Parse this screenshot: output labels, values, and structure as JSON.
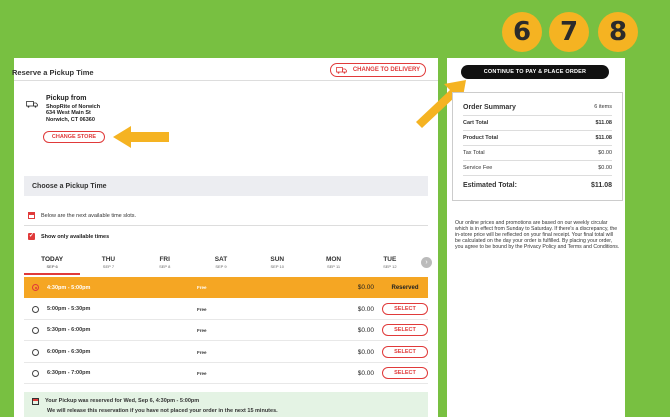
{
  "badges": [
    "6",
    "7",
    "8"
  ],
  "reserve": {
    "title": "Reserve a Pickup Time",
    "change_delivery": "CHANGE TO DELIVERY"
  },
  "pickup": {
    "title": "Pickup from",
    "store_name": "ShopRite of Norwich",
    "address1": "634 West Main St",
    "address2": "Norwich, CT 06360",
    "change_store": "CHANGE STORE"
  },
  "choose": {
    "title": "Choose a Pickup Time",
    "note": "Below are the next available time slots.",
    "checkbox_label": "Show only available times"
  },
  "days": [
    {
      "name": "TODAY",
      "date": "SEP 6"
    },
    {
      "name": "THU",
      "date": "SEP 7"
    },
    {
      "name": "FRI",
      "date": "SEP 8"
    },
    {
      "name": "SAT",
      "date": "SEP 9"
    },
    {
      "name": "SUN",
      "date": "SEP 10"
    },
    {
      "name": "MON",
      "date": "SEP 11"
    },
    {
      "name": "TUE",
      "date": "SEP 12"
    }
  ],
  "slots": [
    {
      "time": "4:30pm - 5:00pm",
      "fee": "Free",
      "price": "$0.00",
      "action": "Reserved"
    },
    {
      "time": "5:00pm - 5:30pm",
      "fee": "Free",
      "price": "$0.00",
      "action": "SELECT"
    },
    {
      "time": "5:30pm - 6:00pm",
      "fee": "Free",
      "price": "$0.00",
      "action": "SELECT"
    },
    {
      "time": "6:00pm - 6:30pm",
      "fee": "Free",
      "price": "$0.00",
      "action": "SELECT"
    },
    {
      "time": "6:30pm - 7:00pm",
      "fee": "Free",
      "price": "$0.00",
      "action": "SELECT"
    }
  ],
  "reserved_msg": {
    "line1": "Your Pickup was reserved for Wed, Sep 6, 4:30pm - 5:00pm",
    "line2": "We will release this reservation if you have not placed your order in the next 15 minutes."
  },
  "summary": {
    "continue": "CONTINUE TO PAY & PLACE ORDER",
    "title": "Order Summary",
    "items": "6 items",
    "cart_total_label": "Cart Total",
    "cart_total": "$11.08",
    "product_total_label": "Product Total",
    "product_total": "$11.08",
    "tax_label": "Tax Total",
    "tax": "$0.00",
    "fee_label": "Service Fee",
    "fee": "$0.00",
    "estimated_label": "Estimated Total:",
    "estimated": "$11.08",
    "disclaimer": "Our online prices and promotions are based on our weekly circular which is in effect from Sunday to Saturday. If there's a discrepancy, the in-store price will be reflected on your final receipt. Your final total will be calculated on the day your order is fulfilled. By placing your order, you agree to be bound by the Privacy Policy and Terms and Conditions."
  },
  "colors": {
    "background": "#78c041",
    "accent_red": "#e03a3a",
    "reserved_orange": "#f5a623",
    "badge_yellow": "#f5b322",
    "arrow_yellow": "#f5b322"
  }
}
